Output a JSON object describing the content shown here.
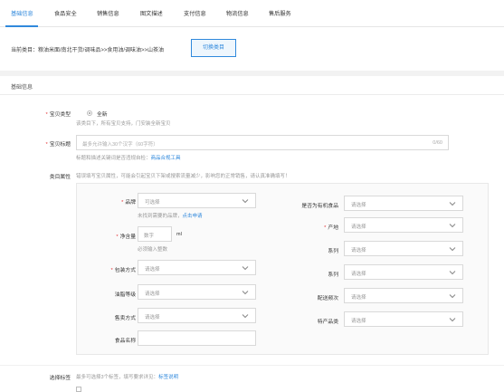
{
  "tabs": [
    {
      "label": "基础信息"
    },
    {
      "label": "食品安全"
    },
    {
      "label": "销售信息"
    },
    {
      "label": "图文描述"
    },
    {
      "label": "支付信息"
    },
    {
      "label": "物流信息"
    },
    {
      "label": "售后服务"
    }
  ],
  "category": {
    "path_label": "当前类目：粮油米面/南北干货/调味品>>食用油/调味油>>山茶油",
    "switch_button": "切换类目"
  },
  "section": {
    "title": "基础信息"
  },
  "item_type": {
    "label": "宝贝类型",
    "option": "全新",
    "hint": "该类目下，所有宝贝支持，门安装全新宝贝"
  },
  "item_title": {
    "label": "宝贝标题",
    "placeholder": "最多允许输入30个汉字（60字符）",
    "counter": "0/60",
    "hint_prefix": "标题和描述关键词是否违规自检：",
    "hint_link": "商品合规工具"
  },
  "attributes": {
    "label": "类目属性",
    "hint": "错误填写宝贝属性，可能会引起宝贝下架或搜索流量减少，影响您的正常销售，请认真准确填写！",
    "left": {
      "brand_label": "品牌",
      "brand_value": "可选择",
      "brand_hint_prefix": "未找到需要的品牌，",
      "brand_hint_link": "点击申请",
      "net_label": "净含量",
      "net_value": "数字",
      "net_unit": "ml",
      "net_hint": "必须输入整数",
      "pack_label": "包装方式",
      "pack_value": "请选择",
      "grade_label": "油脂等级",
      "grade_value": "请选择",
      "sale_label": "售卖方式",
      "sale_value": "请选择",
      "name_label": "食品名称"
    },
    "right": {
      "organic_label": "是否为有机食品",
      "organic_value": "请选择",
      "origin_label": "产地",
      "origin_value": "请选择",
      "cert_label": "系列",
      "cert_value": "请选择",
      "process_label": "系列",
      "process_value": "请选择",
      "level_label": "配送频次",
      "level_value": "请选择",
      "special_label": "特产品类",
      "special_value": "请选择"
    }
  },
  "footer": {
    "label": "选择标签",
    "hint_prefix": "最多可选择3个标签，填写要求详见：",
    "hint_link": "标签说明"
  },
  "colors": {
    "accent": "#3089dc",
    "required": "#e4393c"
  }
}
